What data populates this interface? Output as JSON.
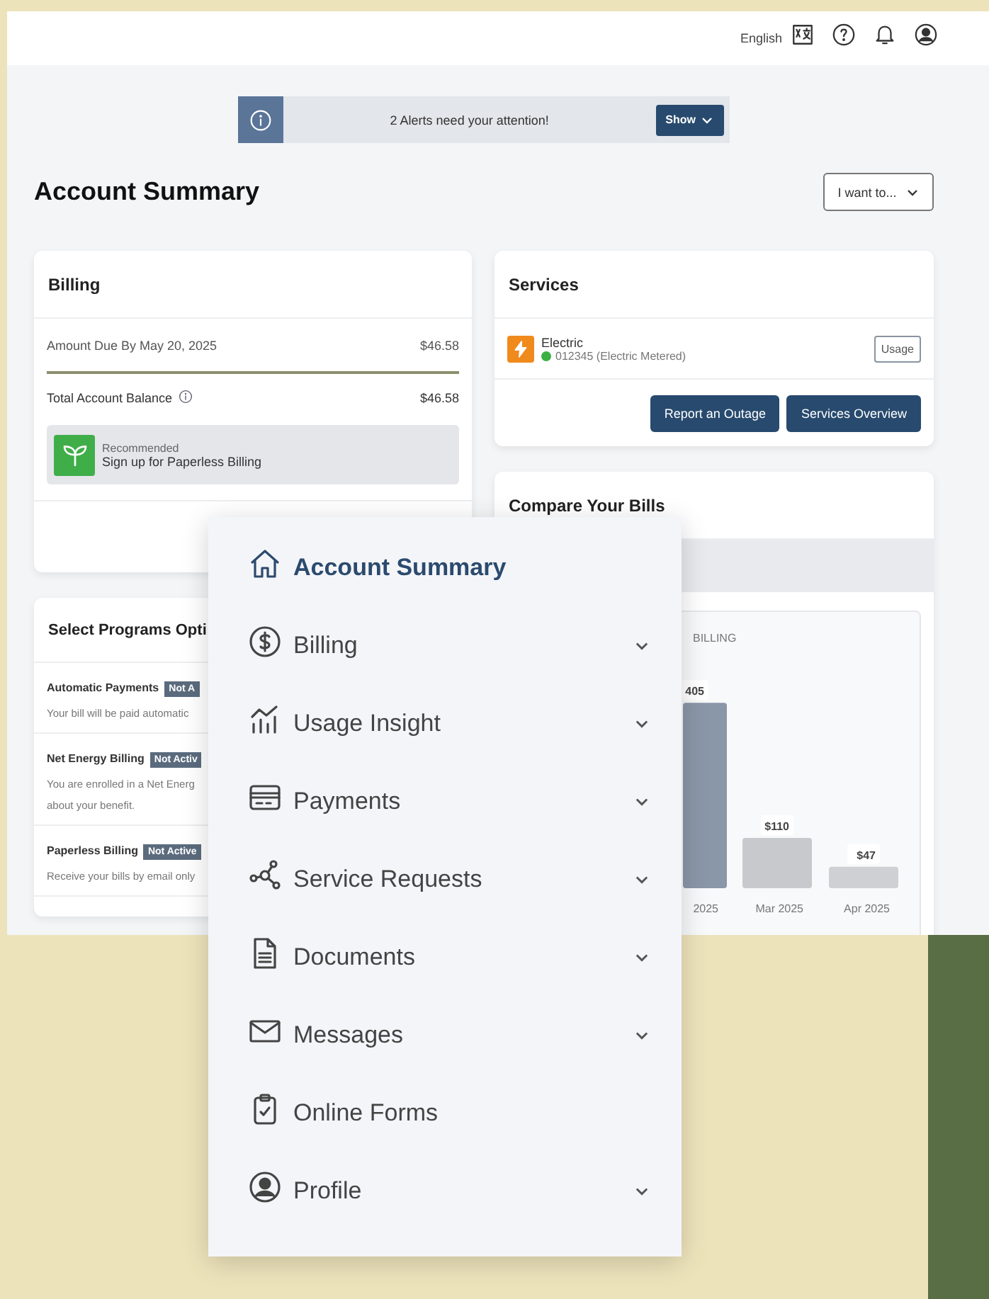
{
  "header": {
    "language": "English"
  },
  "alert": {
    "message": "2 Alerts need your attention!",
    "button": "Show"
  },
  "page_title": "Account Summary",
  "action_menu": "I want to...",
  "billing": {
    "title": "Billing",
    "rows": [
      {
        "label": "Amount Due By May 20, 2025",
        "amount": "$46.58",
        "info": false
      },
      {
        "label": "Total Account Balance",
        "amount": "$46.58",
        "info": true
      }
    ],
    "promo": {
      "caption": "Recommended",
      "text": "Sign up for Paperless Billing"
    }
  },
  "services": {
    "title": "Services",
    "items": [
      {
        "name": "Electric",
        "account": "012345 (Electric Metered)",
        "color": "#3cb043",
        "button": "Usage"
      }
    ],
    "buttons": [
      "Report an Outage",
      "Services Overview"
    ]
  },
  "programs": {
    "title": "Select Programs Opti",
    "items": [
      {
        "name": "Automatic Payments",
        "status": "Not A",
        "description": [
          "Your bill will be paid automatic"
        ]
      },
      {
        "name": "Net Energy Billing",
        "status": "Not Activ",
        "description": [
          "You are enrolled in a Net Energ",
          "about your benefit."
        ]
      },
      {
        "name": "Paperless Billing",
        "status": "Not Active",
        "description": [
          "Receive your bills by email only"
        ]
      }
    ]
  },
  "compare": {
    "title": "Compare Your Bills",
    "chart_data": {
      "type": "bar",
      "title": "BILLING",
      "categories": [
        "2025",
        "Mar 2025",
        "Apr 2025"
      ],
      "values": [
        405,
        110,
        47
      ],
      "value_labels": [
        "405",
        "$110",
        "$47"
      ]
    }
  },
  "nav_menu": {
    "items": [
      {
        "label": "Account Summary",
        "selected": true,
        "expandable": false
      },
      {
        "label": "Billing",
        "selected": false,
        "expandable": true
      },
      {
        "label": "Usage Insight",
        "selected": false,
        "expandable": true
      },
      {
        "label": "Payments",
        "selected": false,
        "expandable": true
      },
      {
        "label": "Service Requests",
        "selected": false,
        "expandable": true
      },
      {
        "label": "Documents",
        "selected": false,
        "expandable": true
      },
      {
        "label": "Messages",
        "selected": false,
        "expandable": true
      },
      {
        "label": "Online Forms",
        "selected": false,
        "expandable": false
      },
      {
        "label": "Profile",
        "selected": false,
        "expandable": true
      }
    ]
  }
}
